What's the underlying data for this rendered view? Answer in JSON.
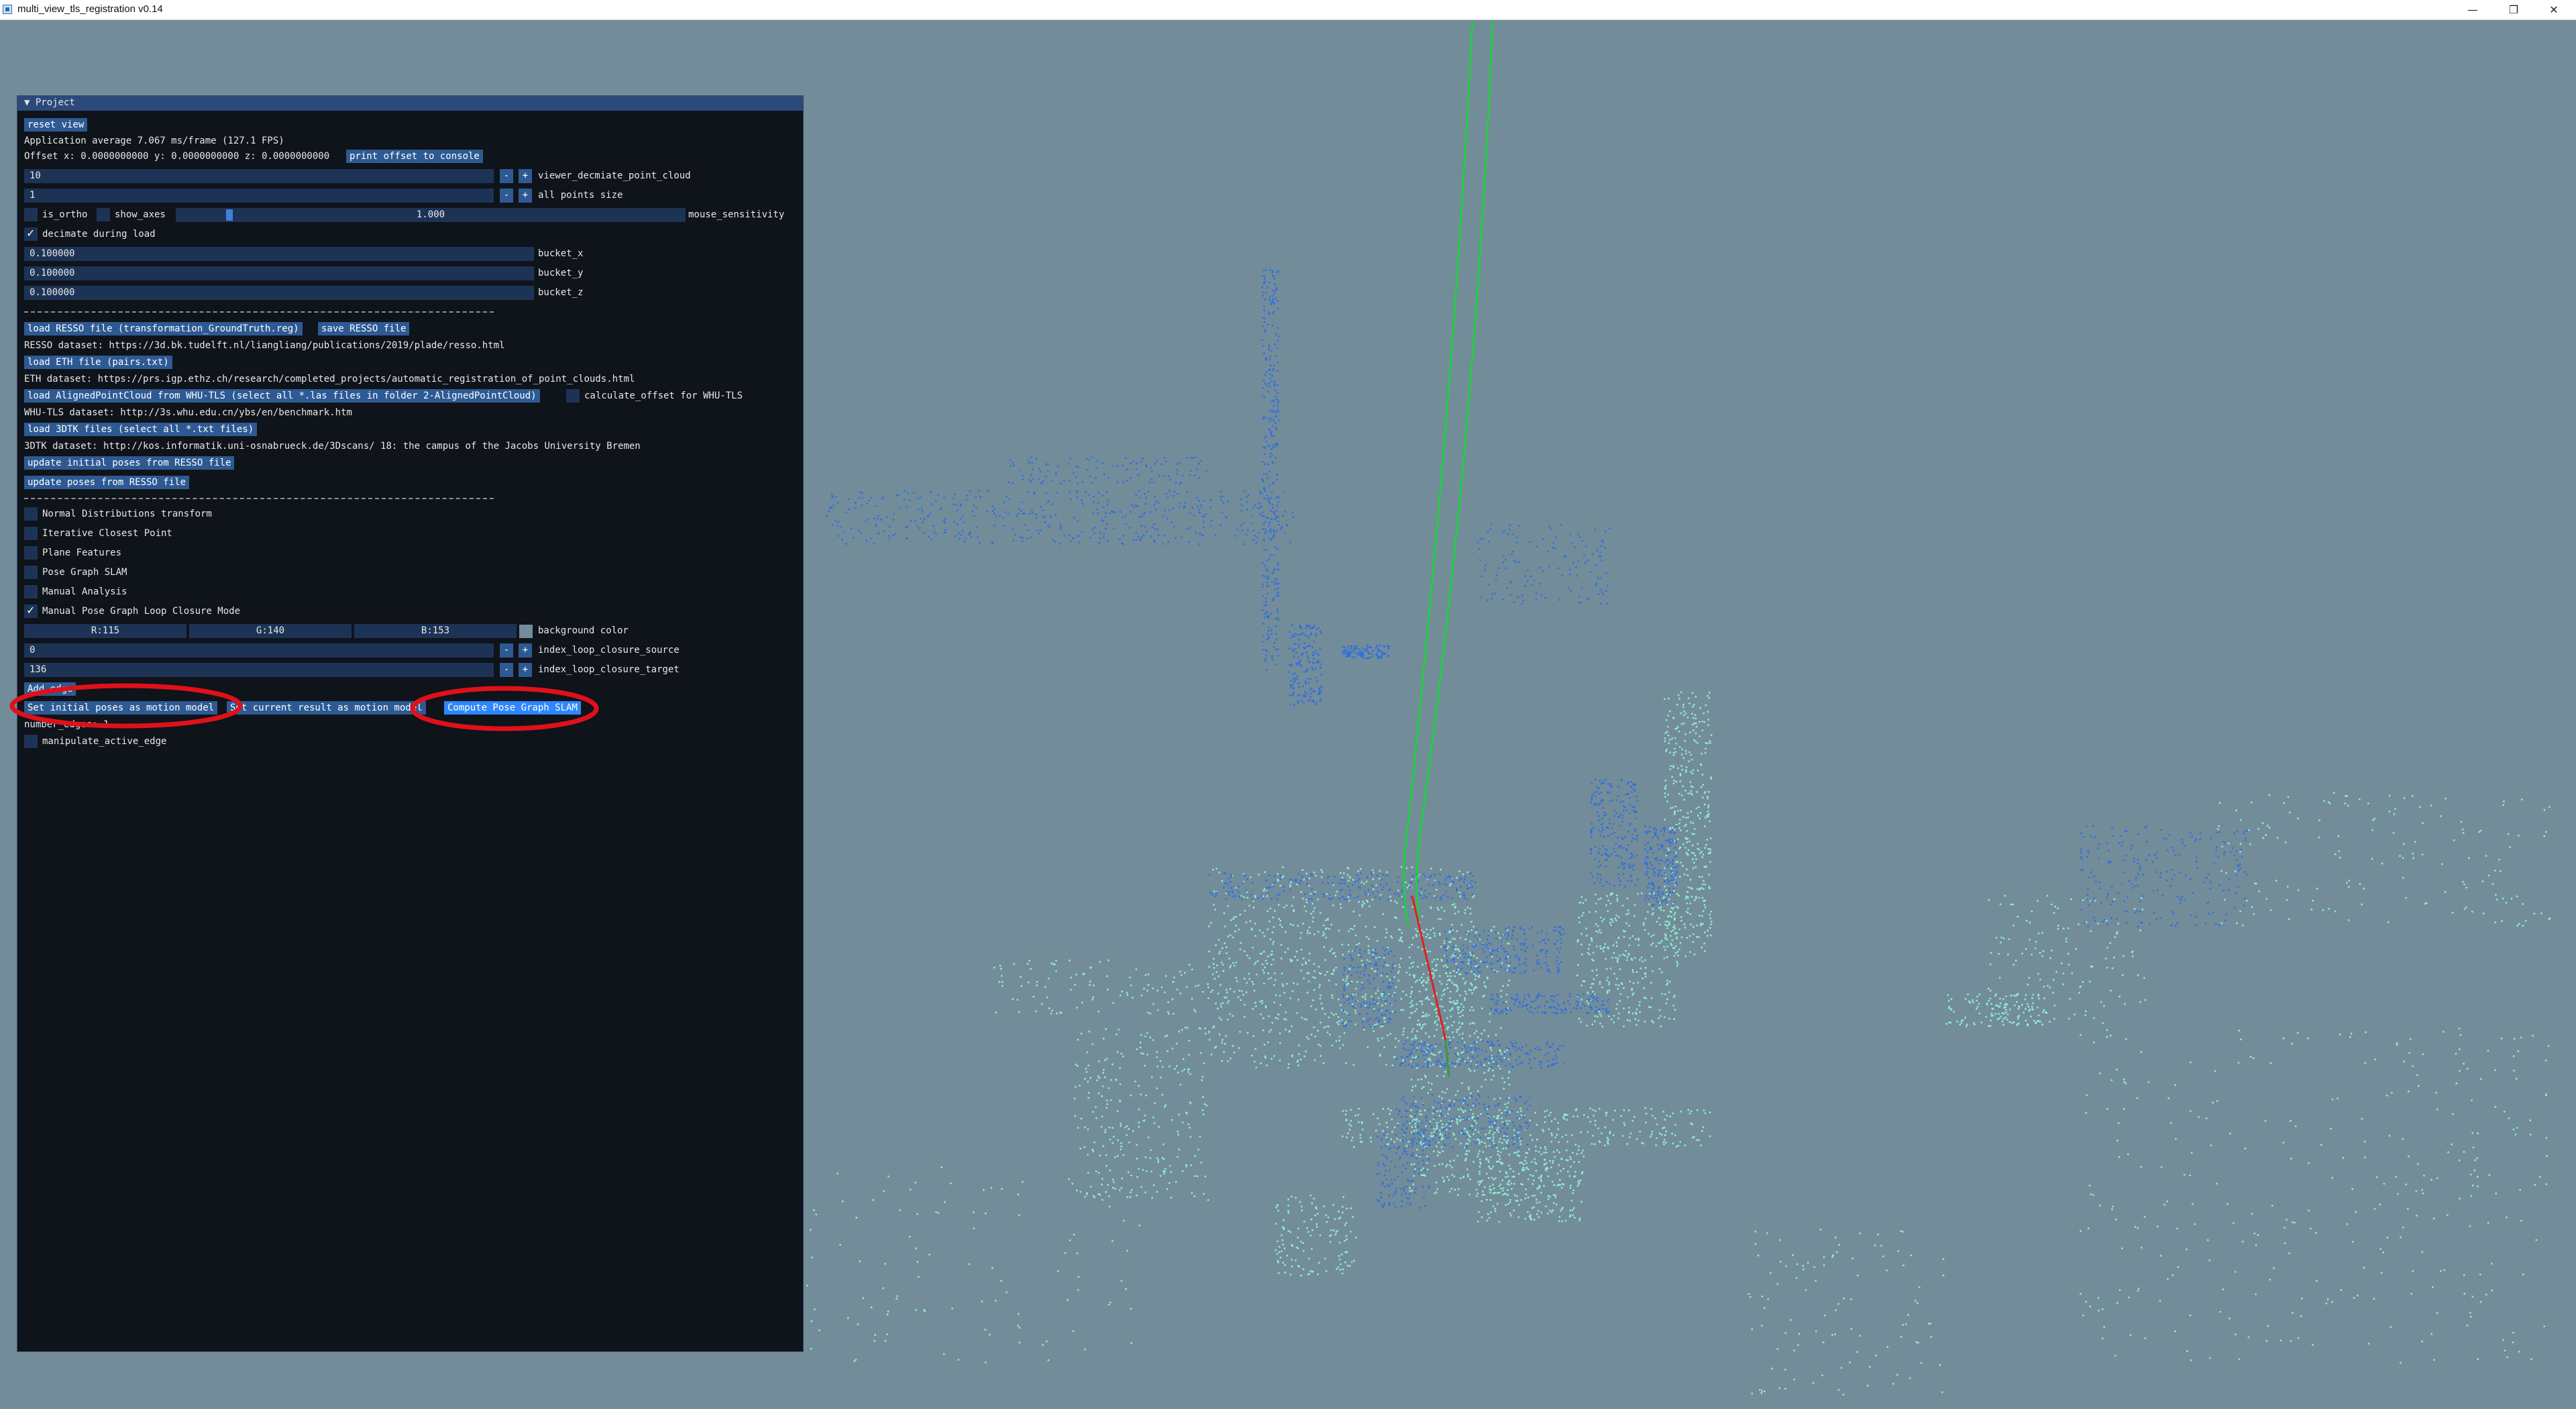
{
  "window": {
    "title": "multi_view_tls_registration v0.14",
    "minimize": "—",
    "maximize": "❐",
    "close": "✕"
  },
  "panel": {
    "header": "▼ Project",
    "reset_view": "reset view",
    "app_average": "Application average 7.067 ms/frame (127.1 FPS)",
    "offset_text": "Offset x: 0.0000000000 y: 0.0000000000 z: 0.0000000000",
    "print_offset_button": "print offset to console",
    "decimate_viewer": {
      "value": "10",
      "label": "viewer_decmiate_point_cloud"
    },
    "points_size": {
      "value": "1",
      "label": "all points size"
    },
    "is_ortho_label": "is_ortho",
    "show_axes_label": "show_axes",
    "mouse_sensitivity": {
      "value": "1.000",
      "label": "mouse_sensitivity",
      "fraction": 0.1
    },
    "decimate_during_load_label": "decimate during load",
    "bucket_x": {
      "value": "0.100000",
      "label": "bucket_x"
    },
    "bucket_y": {
      "value": "0.100000",
      "label": "bucket_y"
    },
    "bucket_z": {
      "value": "0.100000",
      "label": "bucket_z"
    },
    "separator": "-------------------------------------------------------------------------",
    "load_resso_button": "load RESSO file (transformation_GroundTruth.reg)",
    "save_resso_button": "save RESSO file",
    "resso_dataset": "RESSO dataset: https://3d.bk.tudelft.nl/liangliang/publications/2019/plade/resso.html",
    "load_eth_button": "load ETH file (pairs.txt)",
    "eth_dataset": "ETH dataset: https://prs.igp.ethz.ch/research/completed_projects/automatic_registration_of_point_clouds.html",
    "load_whu_button": "load AlignedPointCloud from WHU-TLS (select all *.las files in folder 2-AlignedPointCloud)",
    "calculate_offset_label": "calculate_offset for WHU-TLS",
    "whu_dataset": "WHU-TLS dataset: http://3s.whu.edu.cn/ybs/en/benchmark.htm",
    "load_3dtk_button": "load 3DTK files (select all *.txt files)",
    "dtk_dataset": "3DTK dataset: http://kos.informatik.uni-osnabrueck.de/3Dscans/ 18: the campus of the Jacobs University Bremen",
    "update_initial_poses_button": "update initial poses from RESSO file",
    "update_poses_button": "update poses from RESSO file",
    "modules": [
      {
        "label": "Normal Distributions transform",
        "checked": false
      },
      {
        "label": "Iterative Closest Point",
        "checked": false
      },
      {
        "label": "Plane Features",
        "checked": false
      },
      {
        "label": "Pose Graph SLAM",
        "checked": false
      },
      {
        "label": "Manual Analysis",
        "checked": false
      },
      {
        "label": "Manual Pose Graph Loop Closure Mode",
        "checked": true
      }
    ],
    "bg_r": "R:115",
    "bg_g": "G:140",
    "bg_b": "B:153",
    "background_color_label": "background color",
    "background_color": "#738c99",
    "loop_source": {
      "value": "0",
      "label": "index_loop_closure_source"
    },
    "loop_target": {
      "value": "136",
      "label": "index_loop_closure_target"
    },
    "add_edge_button": "Add edge",
    "set_initial_poses_button": "Set initial poses as motion model",
    "set_current_result_button": "Set current result as motion model",
    "compute_pose_graph_button": "Compute Pose Graph SLAM",
    "number_edges": "number_edges: 1",
    "manipulate_active_edge_label": "manipulate_active_edge",
    "minus": "-",
    "plus": "+"
  },
  "colors": {
    "viewport_background": "#738c99",
    "panel_background": "#0f131a",
    "button": "#2e5a93",
    "button_active": "#2f86ff",
    "annotation": "#e0101a",
    "point_cloud_blue": "#2f6fe0",
    "point_cloud_mint": "#8ff0d0",
    "trajectory_green": "#22cc44",
    "edge_red": "#e02020"
  }
}
